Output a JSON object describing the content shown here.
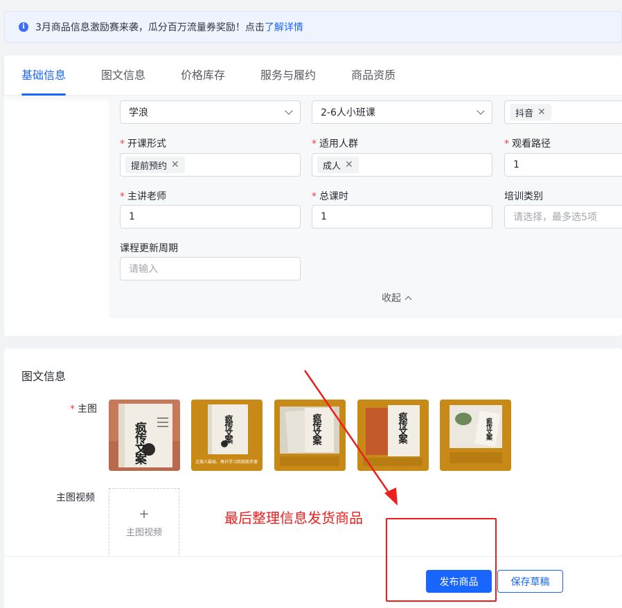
{
  "notice": {
    "text": "3月商品信息激励赛来袭，瓜分百万流量券奖励！点击",
    "link": "了解详情"
  },
  "tabs": [
    {
      "label": "基础信息",
      "active": true
    },
    {
      "label": "图文信息",
      "active": false
    },
    {
      "label": "价格库存",
      "active": false
    },
    {
      "label": "服务与履约",
      "active": false
    },
    {
      "label": "商品资质",
      "active": false
    }
  ],
  "form": {
    "row0": {
      "f1": {
        "value": "学浪"
      },
      "f2": {
        "value": "2-6人小班课"
      },
      "f3": {
        "tag": "抖音"
      }
    },
    "mode": {
      "label": "开课形式",
      "tag": "提前预约"
    },
    "audience": {
      "label": "适用人群",
      "tag": "成人"
    },
    "path": {
      "label": "观看路径",
      "value": "1"
    },
    "teacher": {
      "label": "主讲老师",
      "value": "1"
    },
    "hours": {
      "label": "总课时",
      "value": "1"
    },
    "training": {
      "label": "培训类别",
      "placeholder": "请选择，最多选5项"
    },
    "cycle": {
      "label": "课程更新周期",
      "placeholder": "请输入"
    },
    "collapse": "收起"
  },
  "graphic": {
    "title": "图文信息",
    "main_image_label": "主图",
    "video_label": "主图视频",
    "video_upload": "主图视频",
    "thumbnails": [
      {
        "book_title": "疯传文案",
        "caption": ""
      },
      {
        "book_title": "疯传文案",
        "caption": "文案人破局、再升学习和指南手册"
      },
      {
        "book_title": "疯传文案",
        "caption": ""
      },
      {
        "book_title": "疯传文案",
        "caption": ""
      },
      {
        "book_title": "疯传文案",
        "caption": ""
      }
    ]
  },
  "footer": {
    "publish": "发布商品",
    "save_draft": "保存草稿"
  },
  "annotation": {
    "text": "最后整理信息发货商品",
    "color": "#ee1d1d"
  },
  "colors": {
    "primary": "#1966ff",
    "required": "#f53f3f"
  },
  "icons": [
    "info-icon",
    "chevron-down-icon",
    "close-icon",
    "chevron-up-icon",
    "plus-icon"
  ]
}
